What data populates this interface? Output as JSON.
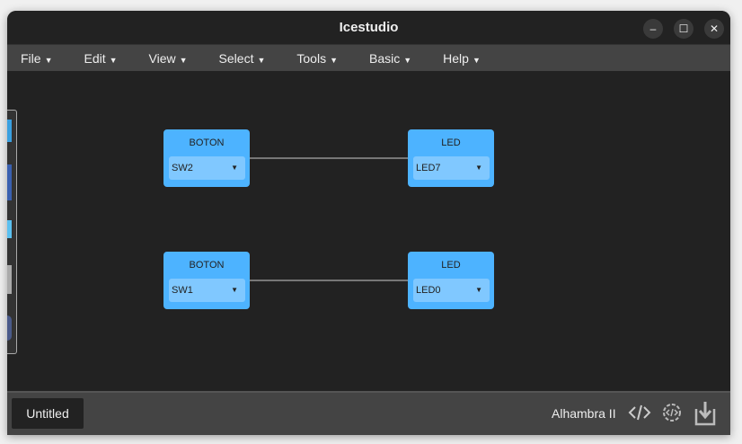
{
  "window": {
    "title": "Icestudio",
    "minimize": "–",
    "maximize": "☐",
    "close": "✕"
  },
  "menu": [
    {
      "label": "File"
    },
    {
      "label": "Edit"
    },
    {
      "label": "View"
    },
    {
      "label": "Select"
    },
    {
      "label": "Tools"
    },
    {
      "label": "Basic"
    },
    {
      "label": "Help"
    }
  ],
  "blocks": [
    {
      "title": "BOTON",
      "value": "SW2"
    },
    {
      "title": "LED",
      "value": "LED7"
    },
    {
      "title": "BOTON",
      "value": "SW1"
    },
    {
      "title": "LED",
      "value": "LED0"
    }
  ],
  "bottom": {
    "tab": "Untitled",
    "board": "Alhambra II"
  },
  "colors": {
    "block": "#4db3ff",
    "select": "#80c8ff",
    "background": "#222222"
  }
}
